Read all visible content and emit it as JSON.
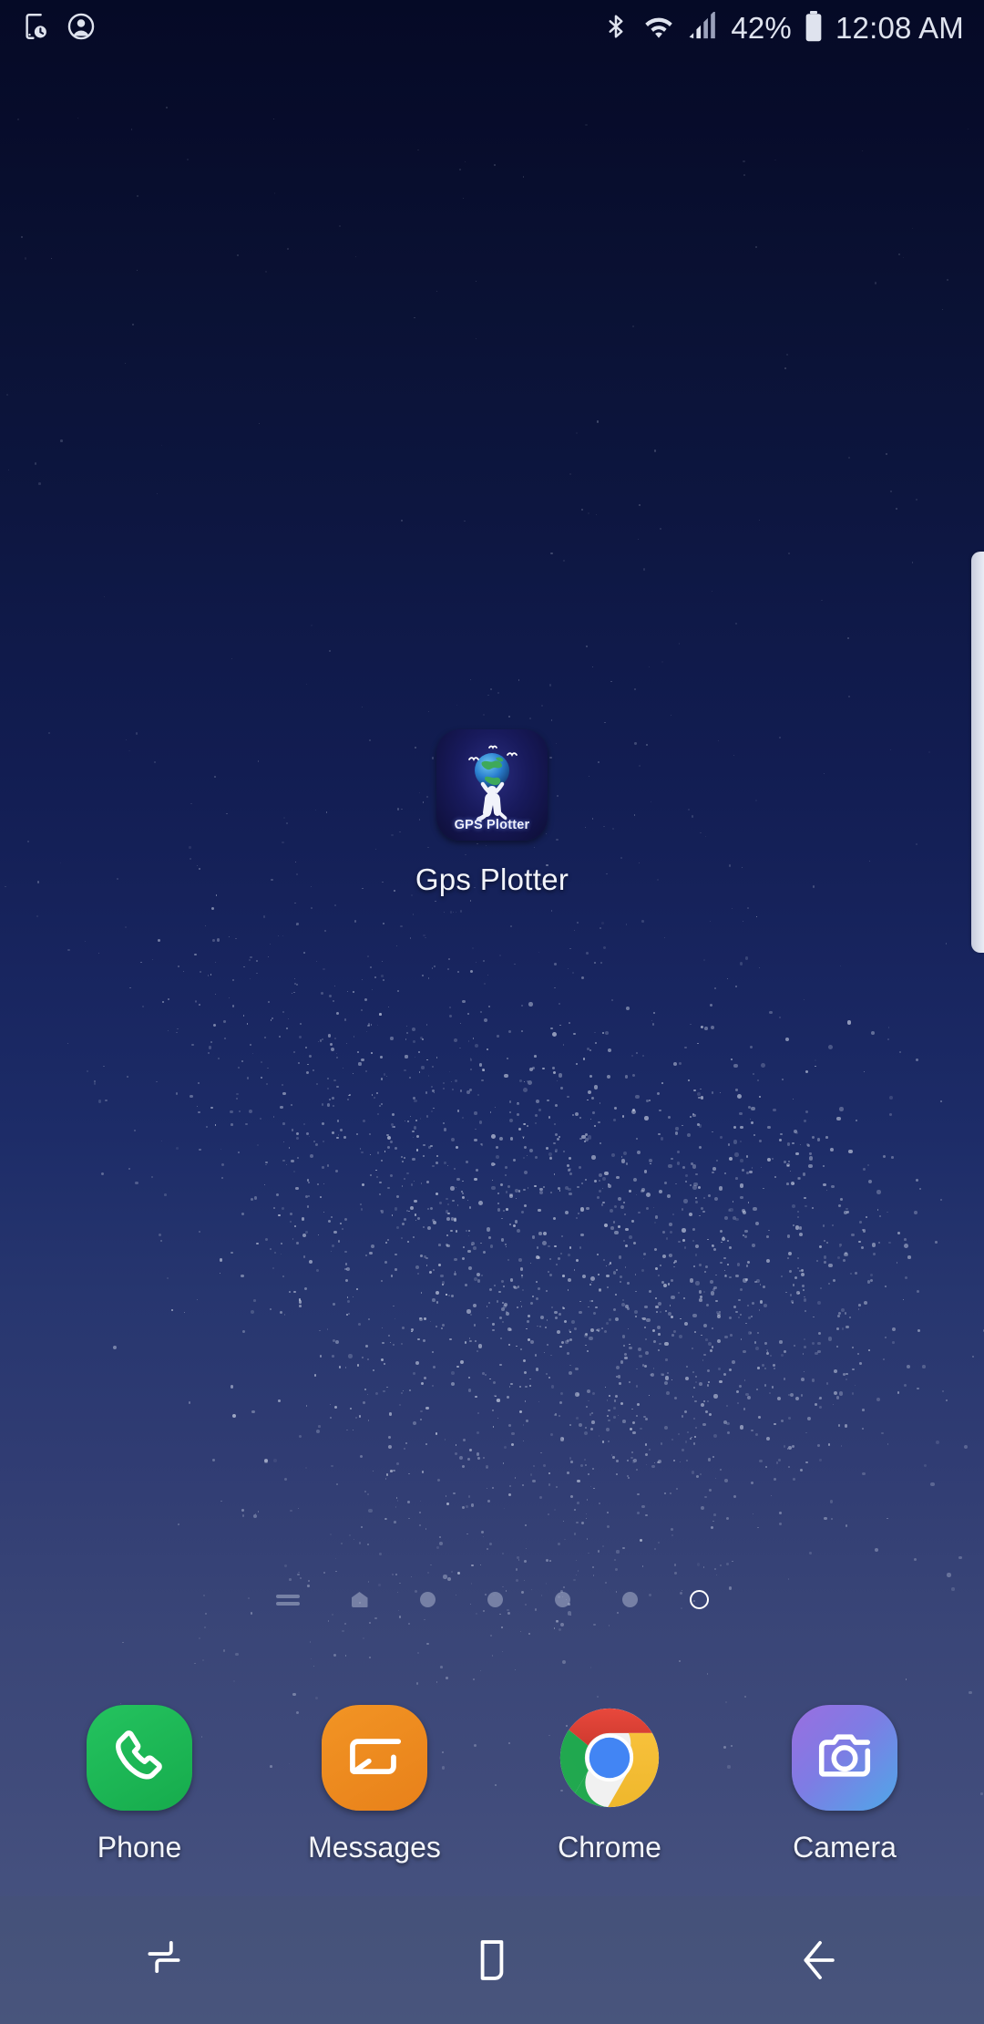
{
  "device": {
    "platform": "Android",
    "launcher": "Samsung One UI Home screen",
    "wallpaper": "dark blue starfield gradient"
  },
  "status_bar": {
    "left_icons": [
      {
        "name": "device-screen-time-icon",
        "label": "Screen time"
      },
      {
        "name": "user-account-icon",
        "label": "Account"
      }
    ],
    "right_icons": [
      {
        "name": "bluetooth-icon",
        "label": "Bluetooth"
      },
      {
        "name": "wifi-icon",
        "label": "Wi-Fi"
      },
      {
        "name": "cellular-signal-icon",
        "label": "Signal"
      }
    ],
    "battery_percent": "42%",
    "battery_icon": "battery-icon",
    "time": "12:08 AM"
  },
  "edge_panel": {
    "name": "edge-panel-handle",
    "label": "Edge panel handle"
  },
  "home_apps": [
    {
      "name": "gps-plotter",
      "label": "Gps Plotter",
      "icon_title": "GPS Plotter",
      "icon_bg": "#181a5c"
    }
  ],
  "page_indicator": {
    "items": [
      {
        "type": "lines",
        "name": "page-indicator-feed",
        "active": false
      },
      {
        "type": "home",
        "name": "page-indicator-home",
        "active": false
      },
      {
        "type": "dot",
        "name": "page-indicator-page-1",
        "active": false
      },
      {
        "type": "dot",
        "name": "page-indicator-page-2",
        "active": false
      },
      {
        "type": "dot",
        "name": "page-indicator-page-3",
        "active": false
      },
      {
        "type": "dot",
        "name": "page-indicator-page-4",
        "active": false
      },
      {
        "type": "current",
        "name": "page-indicator-current",
        "active": true
      }
    ],
    "current_page": 7,
    "total_pages": 7
  },
  "dock": [
    {
      "name": "phone",
      "label": "Phone",
      "icon": "phone-icon",
      "color": "#1fb955"
    },
    {
      "name": "messages",
      "label": "Messages",
      "icon": "message-icon",
      "color": "#ed8b1f"
    },
    {
      "name": "chrome",
      "label": "Chrome",
      "icon": "chrome-icon",
      "color": "#4285f4"
    },
    {
      "name": "camera",
      "label": "Camera",
      "icon": "camera-icon",
      "color": "#8b74e3"
    }
  ],
  "nav_bar": [
    {
      "name": "recents-button",
      "label": "Recents"
    },
    {
      "name": "home-button",
      "label": "Home"
    },
    {
      "name": "back-button",
      "label": "Back"
    }
  ]
}
